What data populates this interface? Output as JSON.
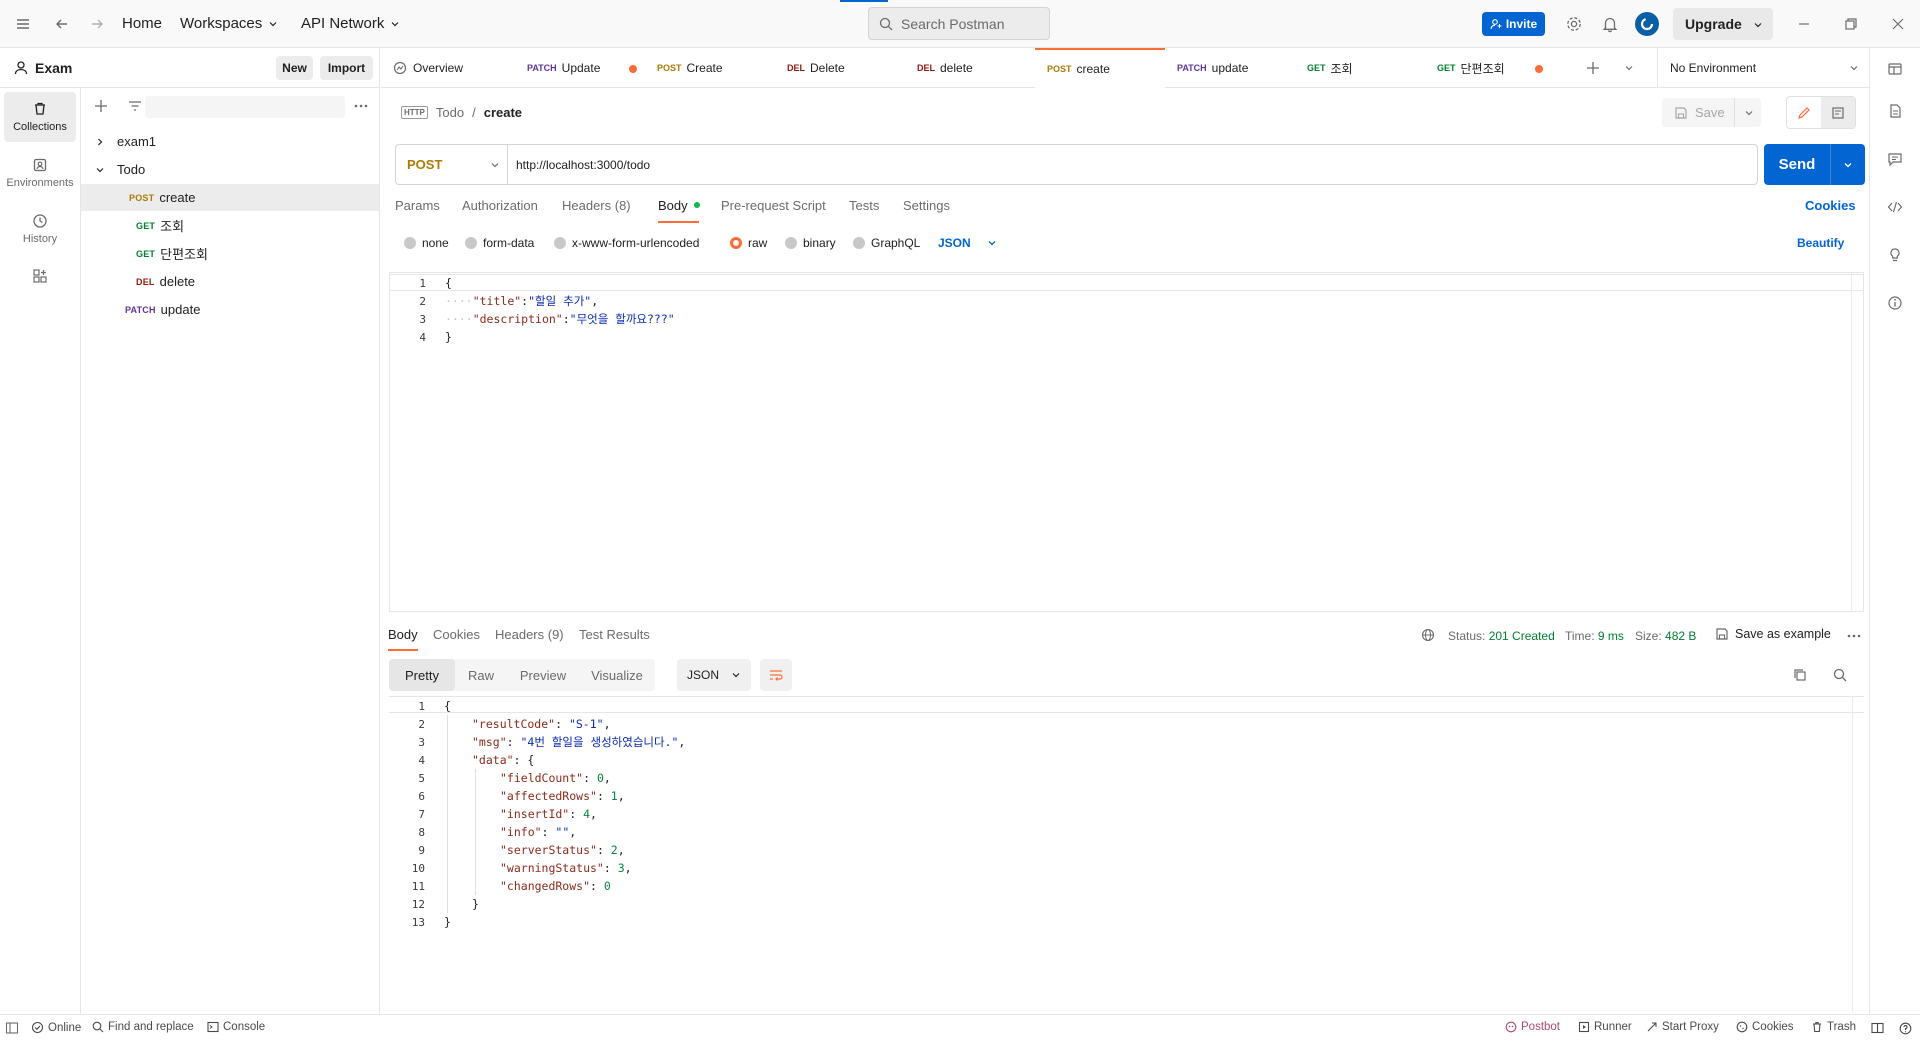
{
  "topbar": {
    "nav": [
      "Home",
      "Workspaces",
      "API Network"
    ],
    "search_placeholder": "Search Postman",
    "invite_label": "Invite",
    "upgrade_label": "Upgrade"
  },
  "leftnav": {
    "workspace_name": "Exam",
    "new_label": "New",
    "import_label": "Import",
    "items": [
      {
        "label": "Collections",
        "icon": "trash-can-icon"
      },
      {
        "label": "Environments",
        "icon": "environment-icon"
      },
      {
        "label": "History",
        "icon": "history-icon"
      },
      {
        "label": "",
        "icon": "apps-icon"
      }
    ]
  },
  "sidebar": {
    "tree": [
      {
        "label": "exam1",
        "type": "collection",
        "expanded": false
      },
      {
        "label": "Todo",
        "type": "collection",
        "expanded": true
      },
      {
        "method": "POST",
        "label": "create",
        "active": true
      },
      {
        "method": "GET",
        "label": "조회"
      },
      {
        "method": "GET",
        "label": "단편조회"
      },
      {
        "method": "DEL",
        "label": "delete"
      },
      {
        "method": "PATCH",
        "label": "update"
      }
    ]
  },
  "tabs": [
    {
      "method": "",
      "label": "Overview"
    },
    {
      "method": "PATCH",
      "label": "Update",
      "unsaved": true
    },
    {
      "method": "POST",
      "label": "Create"
    },
    {
      "method": "DEL",
      "label": "Delete"
    },
    {
      "method": "DEL",
      "label": "delete"
    },
    {
      "method": "POST",
      "label": "create",
      "active": true
    },
    {
      "method": "PATCH",
      "label": "update"
    },
    {
      "method": "GET",
      "label": "조회"
    },
    {
      "method": "GET",
      "label": "단편조회",
      "unsaved": true
    }
  ],
  "environment": "No Environment",
  "request": {
    "breadcrumb_parent": "Todo",
    "breadcrumb_sep": "/",
    "breadcrumb_current": "create",
    "http_badge": "HTTP",
    "save_label": "Save",
    "method": "POST",
    "url": "http://localhost:3000/todo",
    "send_label": "Send",
    "tabs": [
      "Params",
      "Authorization",
      "Headers (8)",
      "Body",
      "Pre-request Script",
      "Tests",
      "Settings"
    ],
    "cookies_label": "Cookies",
    "body_options": [
      "none",
      "form-data",
      "x-www-form-urlencoded",
      "raw",
      "binary",
      "GraphQL"
    ],
    "body_format": "JSON",
    "beautify_label": "Beautify",
    "body_lines": [
      {
        "n": "1",
        "text": "{"
      },
      {
        "n": "2",
        "key": "\"title\"",
        "sep": ":",
        "val": "\"할일 추가\"",
        "end": ","
      },
      {
        "n": "3",
        "key": "\"description\"",
        "sep": ":",
        "val": "\"무엇을 할까요???\"",
        "end": ""
      },
      {
        "n": "4",
        "text": "}"
      }
    ]
  },
  "response": {
    "tabs": [
      "Body",
      "Cookies",
      "Headers (9)",
      "Test Results"
    ],
    "status_label": "Status:",
    "status_value": "201 Created",
    "time_label": "Time:",
    "time_value": "9 ms",
    "size_label": "Size:",
    "size_value": "482 B",
    "save_example_label": "Save as example",
    "view_modes": [
      "Pretty",
      "Raw",
      "Preview",
      "Visualize"
    ],
    "format": "JSON",
    "lines": [
      {
        "n": "1",
        "indent": 0,
        "text": "{"
      },
      {
        "n": "2",
        "indent": 1,
        "key": "\"resultCode\"",
        "val": "\"S-1\"",
        "vtype": "s",
        "end": ","
      },
      {
        "n": "3",
        "indent": 1,
        "key": "\"msg\"",
        "val": "\"4번 할일을 생성하였습니다.\"",
        "vtype": "s",
        "end": ","
      },
      {
        "n": "4",
        "indent": 1,
        "key": "\"data\"",
        "val": "{",
        "vtype": "p",
        "end": ""
      },
      {
        "n": "5",
        "indent": 2,
        "key": "\"fieldCount\"",
        "val": "0",
        "vtype": "n",
        "end": ","
      },
      {
        "n": "6",
        "indent": 2,
        "key": "\"affectedRows\"",
        "val": "1",
        "vtype": "n",
        "end": ","
      },
      {
        "n": "7",
        "indent": 2,
        "key": "\"insertId\"",
        "val": "4",
        "vtype": "n",
        "end": ","
      },
      {
        "n": "8",
        "indent": 2,
        "key": "\"info\"",
        "val": "\"\"",
        "vtype": "s",
        "end": ","
      },
      {
        "n": "9",
        "indent": 2,
        "key": "\"serverStatus\"",
        "val": "2",
        "vtype": "n",
        "end": ","
      },
      {
        "n": "10",
        "indent": 2,
        "key": "\"warningStatus\"",
        "val": "3",
        "vtype": "n",
        "end": ","
      },
      {
        "n": "11",
        "indent": 2,
        "key": "\"changedRows\"",
        "val": "0",
        "vtype": "n",
        "end": ""
      },
      {
        "n": "12",
        "indent": 1,
        "text": "}"
      },
      {
        "n": "13",
        "indent": 0,
        "text": "}"
      }
    ]
  },
  "statusbar": {
    "online": "Online",
    "find_replace": "Find and replace",
    "console": "Console",
    "postbot": "Postbot",
    "runner": "Runner",
    "start_proxy": "Start Proxy",
    "cookies": "Cookies",
    "trash": "Trash"
  },
  "colors": {
    "accent": "#ff6c37",
    "primary": "#0265d2",
    "status_ok": "#007f31"
  }
}
